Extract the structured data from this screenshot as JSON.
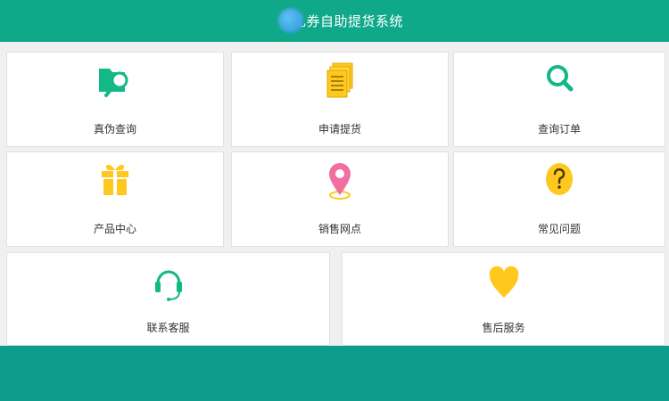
{
  "header": {
    "title": "礼券自助提货系统"
  },
  "tiles": [
    {
      "label": "真伪查询",
      "icon": "folder-search-icon"
    },
    {
      "label": "申请提货",
      "icon": "documents-icon"
    },
    {
      "label": "查询订单",
      "icon": "search-icon"
    },
    {
      "label": "产品中心",
      "icon": "gift-icon"
    },
    {
      "label": "销售网点",
      "icon": "location-pin-icon"
    },
    {
      "label": "常见问题",
      "icon": "question-icon"
    },
    {
      "label": "联系客服",
      "icon": "headset-icon"
    },
    {
      "label": "售后服务",
      "icon": "heart-icon"
    }
  ],
  "colors": {
    "header": "#0fa888",
    "footer": "#0d9c8c",
    "green_icon": "#12b886",
    "yellow_icon": "#ffc81e",
    "pink_icon": "#f06fa0"
  }
}
